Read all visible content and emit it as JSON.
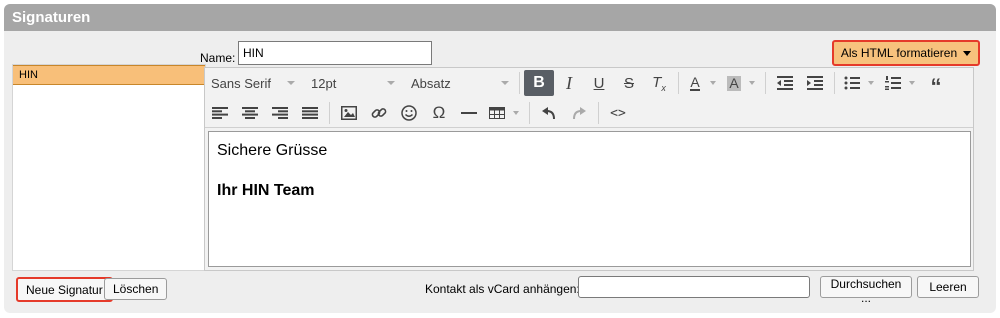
{
  "header": {
    "title": "Signaturen"
  },
  "name_field": {
    "label": "Name:",
    "value": "HIN"
  },
  "format_button": {
    "label": "Als HTML formatieren"
  },
  "signatures": {
    "items": [
      {
        "label": "HIN",
        "selected": true
      }
    ]
  },
  "toolbar": {
    "font_family": "Sans Serif",
    "font_size": "12pt",
    "block_format": "Absatz",
    "icons_row1": [
      "bold-icon",
      "italic-icon",
      "underline-icon",
      "strikethrough-icon",
      "clear-format-icon",
      "text-color-icon",
      "background-color-icon",
      "outdent-icon",
      "indent-icon",
      "bullet-list-icon",
      "numbered-list-icon",
      "blockquote-icon"
    ],
    "icons_row2": [
      "align-left-icon",
      "align-center-icon",
      "align-right-icon",
      "align-justify-icon",
      "image-icon",
      "link-icon",
      "emoji-icon",
      "special-char-icon",
      "horizontal-rule-icon",
      "table-icon",
      "undo-icon",
      "redo-icon",
      "source-code-icon"
    ]
  },
  "editor": {
    "line1": "Sichere Grüsse",
    "line2": "Ihr HIN Team"
  },
  "buttons": {
    "new_signature": "Neue Signatur",
    "delete": "Löschen",
    "browse": "Durchsuchen ...",
    "clear": "Leeren"
  },
  "vcard": {
    "label": "Kontakt als vCard anhängen:",
    "value": ""
  },
  "colors": {
    "accent": "#f7c27d",
    "highlight_border": "#e53a2a",
    "header_bg": "#a6a6a6",
    "active_button": "#595e65"
  }
}
